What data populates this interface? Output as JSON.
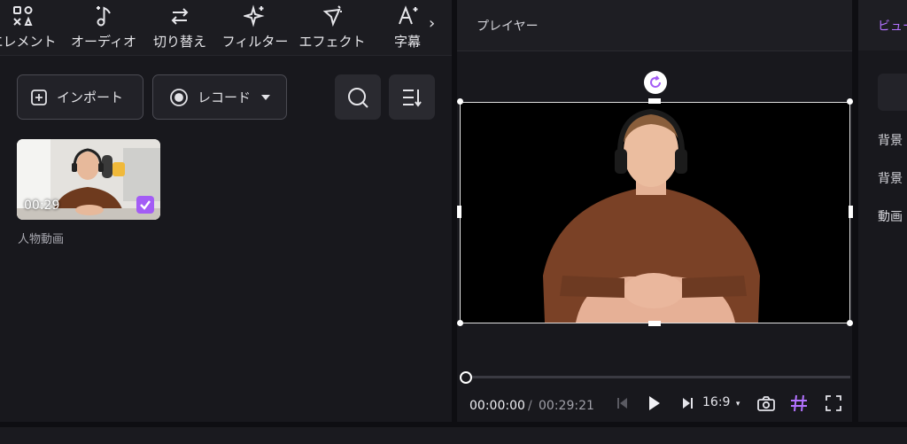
{
  "toolbar": {
    "items": [
      {
        "label": "エレメント",
        "icon": "elements-icon"
      },
      {
        "label": "オーディオ",
        "icon": "audio-icon"
      },
      {
        "label": "切り替え",
        "icon": "transition-icon"
      },
      {
        "label": "フィルター",
        "icon": "filter-icon"
      },
      {
        "label": "エフェクト",
        "icon": "effect-icon"
      },
      {
        "label": "字幕",
        "icon": "text-icon"
      }
    ],
    "more_icon": "chevron-right-icon"
  },
  "media": {
    "import_label": "インポート",
    "record_label": "レコード",
    "clips": [
      {
        "duration": "00:29",
        "name": "人物動画",
        "selected": true
      }
    ]
  },
  "player": {
    "title": "プレイヤー",
    "current_time": "00:00:00",
    "separator": "/",
    "total_time": "00:29:21",
    "aspect_ratio": "16:9",
    "progress": 0
  },
  "right_panel": {
    "tab": "ビュー",
    "labels": [
      "背景",
      "背景",
      "動画"
    ]
  },
  "colors": {
    "accent": "#a35cf5",
    "tab_active": "#b372ff",
    "panel": "#18181d"
  }
}
